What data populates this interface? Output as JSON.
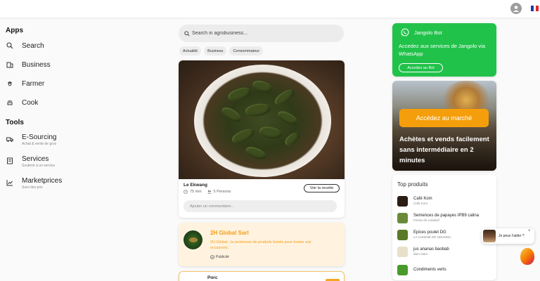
{
  "colors": {
    "accent_green": "#21c24a",
    "accent_orange": "#f59e0b",
    "promo_bg": "#fff3e0"
  },
  "sidebar": {
    "apps_title": "Apps",
    "apps": [
      {
        "label": "Search",
        "icon": "search-icon"
      },
      {
        "label": "Business",
        "icon": "building-icon"
      },
      {
        "label": "Farmer",
        "icon": "farmer-icon"
      },
      {
        "label": "Cook",
        "icon": "cook-icon"
      }
    ],
    "tools_title": "Tools",
    "tools": [
      {
        "label": "E-Sourcing",
        "sub": "Achat & vente de gros",
        "icon": "truck-icon"
      },
      {
        "label": "Services",
        "sub": "Soutenir à un service",
        "icon": "document-icon"
      },
      {
        "label": "Marketprices",
        "sub": "Suivi des prix",
        "icon": "chart-icon"
      }
    ]
  },
  "feed": {
    "search_placeholder": "Search in agrobusiness...",
    "chips": [
      "Actualité",
      "Business",
      "Consommateur"
    ],
    "recipe": {
      "title": "Le Ekwang",
      "time": "75 min",
      "persons": "5 Persons",
      "button": "Voir la recette",
      "comment_placeholder": "Ajouter un commentaire..."
    },
    "promo": {
      "name": "2H Global Sarl",
      "desc": "2H Global , la promesse de produits fumés pour toutes vos occasions.",
      "pub": "Publicité"
    },
    "post2_title": "Porc"
  },
  "right": {
    "bot_title": "Jangolo Bot",
    "bot_text": "Accedez aux services de Jangolo via WhatsApp",
    "bot_button": "Accedez au Bot",
    "market_button": "Accédez au marché",
    "market_text": "Achètes et vends facilement sans intermédiaire en 2 minutes",
    "top_title": "Top produits",
    "products": [
      {
        "name": "Café Kom",
        "seller": "Café Kom",
        "color": "#2b1d14"
      },
      {
        "name": "Semences de papayes IPB9 calina",
        "seller": "Ferme de Lolodorf",
        "color": "#6a8a3a"
      },
      {
        "name": "Epices poulet DG",
        "seller": "LA CUISINE DE NOUNOU",
        "color": "#5a7a2a"
      },
      {
        "name": "jus ananas baobab",
        "seller": "dam natur",
        "color": "#e8e0c8"
      },
      {
        "name": "Condiments verts",
        "seller": "",
        "color": "#4a9a2a"
      }
    ]
  },
  "chat": {
    "message": "Je peux t'aider ?",
    "close": "×"
  }
}
